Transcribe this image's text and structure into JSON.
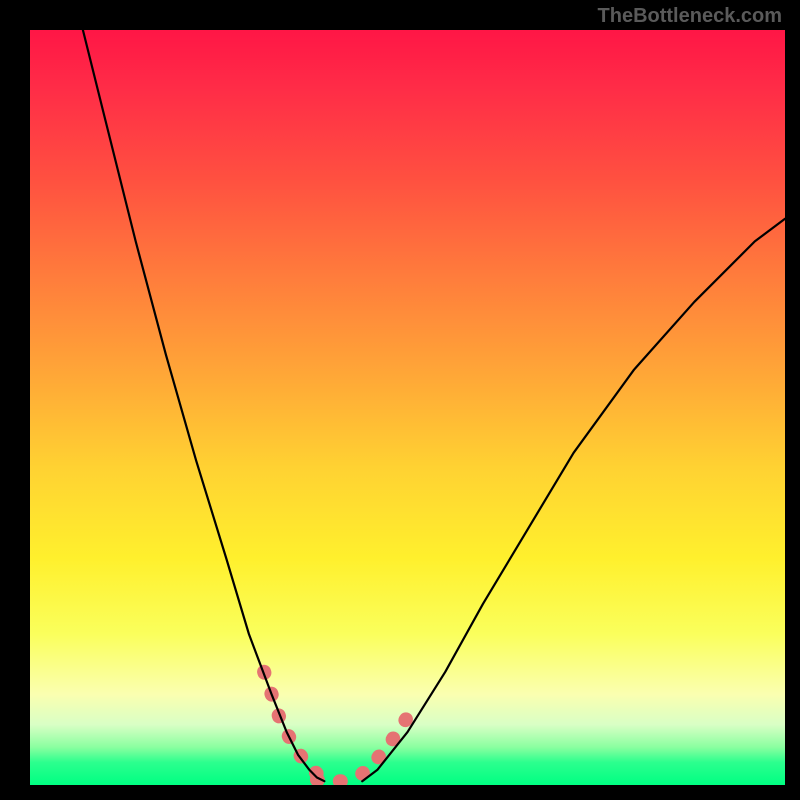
{
  "watermark": "TheBottleneck.com",
  "chart_data": {
    "type": "line",
    "title": "",
    "xlabel": "",
    "ylabel": "",
    "xlim": [
      0,
      100
    ],
    "ylim": [
      0,
      100
    ],
    "grid": false,
    "background": "rainbow-gradient",
    "series": [
      {
        "name": "left-curve",
        "color": "#000000",
        "x": [
          7,
          10,
          14,
          18,
          22,
          26,
          29,
          32,
          34,
          35.5,
          37,
          38,
          39
        ],
        "y": [
          100,
          88,
          72,
          57,
          43,
          30,
          20,
          12,
          7,
          4,
          2,
          1,
          0.5
        ]
      },
      {
        "name": "right-curve",
        "color": "#000000",
        "x": [
          44,
          46,
          50,
          55,
          60,
          66,
          72,
          80,
          88,
          96,
          100
        ],
        "y": [
          0.5,
          2,
          7,
          15,
          24,
          34,
          44,
          55,
          64,
          72,
          75
        ]
      },
      {
        "name": "left-highlight",
        "color": "#E57373",
        "stroke_width": 14,
        "x": [
          31,
          33,
          35,
          36.5,
          38
        ],
        "y": [
          15,
          9,
          5,
          3,
          1.5
        ]
      },
      {
        "name": "bottom-highlight",
        "color": "#E57373",
        "stroke_width": 14,
        "x": [
          38,
          40,
          42,
          44
        ],
        "y": [
          0.7,
          0.5,
          0.5,
          0.7
        ]
      },
      {
        "name": "right-highlight",
        "color": "#E57373",
        "stroke_width": 14,
        "x": [
          44,
          46,
          48,
          50
        ],
        "y": [
          1.5,
          3.5,
          6,
          9
        ]
      }
    ]
  }
}
